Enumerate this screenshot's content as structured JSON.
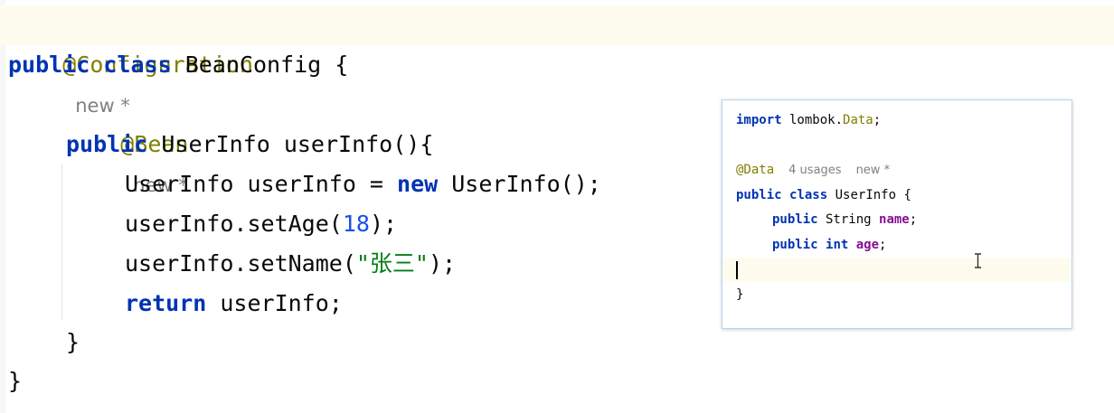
{
  "editor": {
    "hint_text": "new *",
    "line1": {
      "annotation": "@Configuration"
    },
    "line2": {
      "kw_public": "public",
      "kw_class": "class",
      "rest": " BeanConfig {"
    },
    "line3": {
      "annotation": "@Bean"
    },
    "line4": {
      "kw_public": "public",
      "rest": " UserInfo userInfo(){"
    },
    "line5": {
      "prefix": "UserInfo userInfo = ",
      "kw_new": "new",
      "rest": " UserInfo();"
    },
    "line6": {
      "prefix": "userInfo.setAge(",
      "number": "18",
      "suffix": ");"
    },
    "line7": {
      "prefix": "userInfo.setName(",
      "string": "\"张三\"",
      "suffix": ");"
    },
    "line8": {
      "kw_return": "return",
      "rest": " userInfo;"
    },
    "line9": {
      "text": "}"
    },
    "line10": {
      "text": "}"
    }
  },
  "popup": {
    "line1": {
      "kw_import": "import",
      "pkg": " lombok.",
      "ann": "Data",
      "semi": ";"
    },
    "line2": {
      "annotation": "@Data",
      "usages": "4 usages",
      "hint": "new *"
    },
    "line3": {
      "kw_public": "public",
      "kw_class": "class",
      "rest": " UserInfo {"
    },
    "line4": {
      "kw_public": "public",
      "type": " String ",
      "field": "name",
      "semi": ";"
    },
    "line5": {
      "kw_public": "public",
      "kw_int": "int",
      "field": "age",
      "semi": ";"
    },
    "line6": {
      "text": "}"
    }
  },
  "colors": {
    "keyword": "#0033b3",
    "annotation": "#808000",
    "number": "#1750eb",
    "string": "#067d17",
    "field": "#871094",
    "hint": "#808080",
    "current_line": "#fefcef"
  }
}
